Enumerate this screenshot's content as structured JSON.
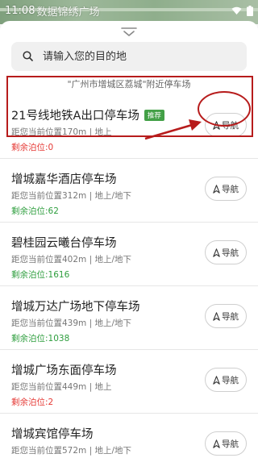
{
  "status_bar": {
    "time": "11:08",
    "map_text": "数据锦绣广场"
  },
  "search": {
    "placeholder": "请输入您的目的地"
  },
  "region_hint": "\"广州市增城区荔城\"附近停车场",
  "nav_label": "导航",
  "highlight_color": "#b71c1c",
  "parking_lots": [
    {
      "name": "21号线地铁A出口停车场",
      "tag": "推荐",
      "distance": "距您当前位置170m | 地上",
      "spaces": "剩余泊位:0",
      "spaces_color": "red"
    },
    {
      "name": "增城嘉华酒店停车场",
      "tag": "",
      "distance": "距您当前位置312m | 地上/地下",
      "spaces": "剩余泊位:62",
      "spaces_color": "green"
    },
    {
      "name": "碧桂园云曦台停车场",
      "tag": "",
      "distance": "距您当前位置402m | 地上/地下",
      "spaces": "剩余泊位:1616",
      "spaces_color": "green"
    },
    {
      "name": "增城万达广场地下停车场",
      "tag": "",
      "distance": "距您当前位置439m | 地上/地下",
      "spaces": "剩余泊位:1038",
      "spaces_color": "green"
    },
    {
      "name": "增城广场东面停车场",
      "tag": "",
      "distance": "距您当前位置449m | 地上",
      "spaces": "剩余泊位:2",
      "spaces_color": "red"
    },
    {
      "name": "增城宾馆停车场",
      "tag": "",
      "distance": "距您当前位置572m | 地上/地下",
      "spaces": "剩余泊位:86",
      "spaces_color": "green"
    }
  ]
}
